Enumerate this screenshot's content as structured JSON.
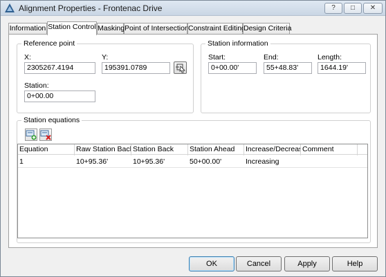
{
  "window": {
    "title": "Alignment Properties - Frontenac Drive",
    "controls": {
      "help": "?",
      "restore": "□",
      "close": "✕"
    }
  },
  "tabs": [
    {
      "label": "Information"
    },
    {
      "label": "Station Control"
    },
    {
      "label": "Masking"
    },
    {
      "label": "Point of Intersection"
    },
    {
      "label": "Constraint Editing"
    },
    {
      "label": "Design Criteria"
    }
  ],
  "reference_point": {
    "group_label": "Reference point",
    "x_label": "X:",
    "x_value": "2305267.4194",
    "y_label": "Y:",
    "y_value": "195391.0789",
    "station_label": "Station:",
    "station_value": "0+00.00"
  },
  "station_information": {
    "group_label": "Station information",
    "start_label": "Start:",
    "start_value": "0+00.00'",
    "end_label": "End:",
    "end_value": "55+48.83'",
    "length_label": "Length:",
    "length_value": "1644.19'"
  },
  "station_equations": {
    "group_label": "Station equations",
    "columns": [
      "Equation",
      "Raw Station Back",
      "Station Back",
      "Station Ahead",
      "Increase/Decrease",
      "Comment"
    ],
    "rows": [
      [
        "1",
        "10+95.36'",
        "10+95.36'",
        "50+00.00'",
        "Increasing",
        ""
      ]
    ]
  },
  "buttons": {
    "ok": "OK",
    "cancel": "Cancel",
    "apply": "Apply",
    "help": "Help"
  }
}
